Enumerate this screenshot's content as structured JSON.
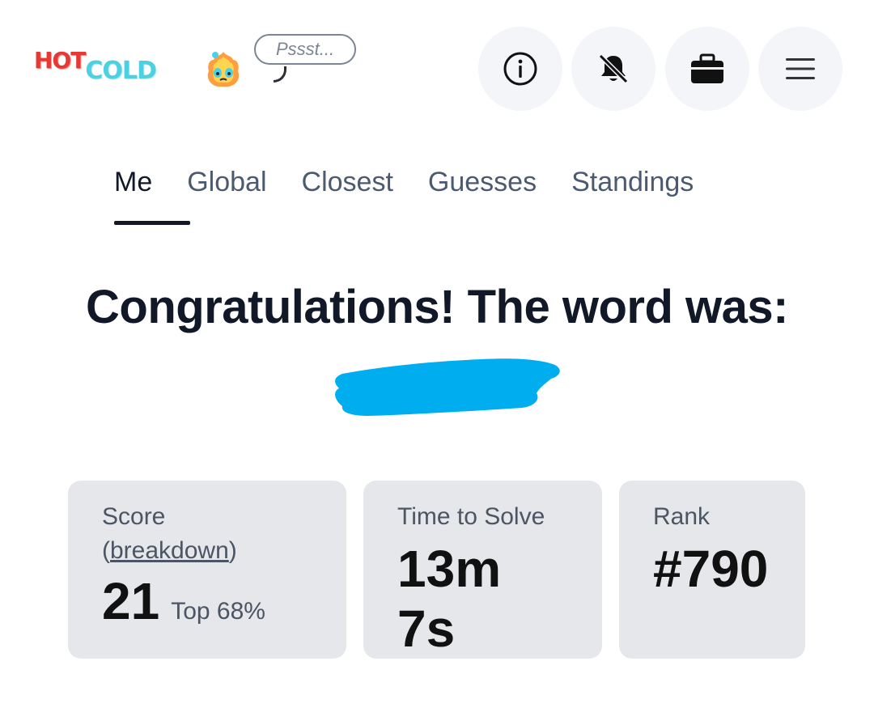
{
  "header": {
    "logo_hot": "HOT",
    "logo_cold": "COLD",
    "speech_bubble": "Pssst...",
    "icons": [
      "info-icon",
      "bell-off-icon",
      "briefcase-icon",
      "menu-icon"
    ]
  },
  "tabs": [
    {
      "label": "Me",
      "active": true
    },
    {
      "label": "Global",
      "active": false
    },
    {
      "label": "Closest",
      "active": false
    },
    {
      "label": "Guesses",
      "active": false
    },
    {
      "label": "Standings",
      "active": false
    }
  ],
  "result": {
    "headline": "Congratulations! The word was:"
  },
  "stats": {
    "score": {
      "label": "Score",
      "paren_open": "(",
      "link": "breakdown",
      "paren_close": ")",
      "value": "21",
      "percentile": "Top 68%"
    },
    "time": {
      "label": "Time to Solve",
      "value": "13m 7s"
    },
    "rank": {
      "label": "Rank",
      "value": "#790"
    }
  },
  "colors": {
    "redaction": "#00aeef",
    "hot": "#e53935",
    "cold": "#4dd0e1"
  }
}
